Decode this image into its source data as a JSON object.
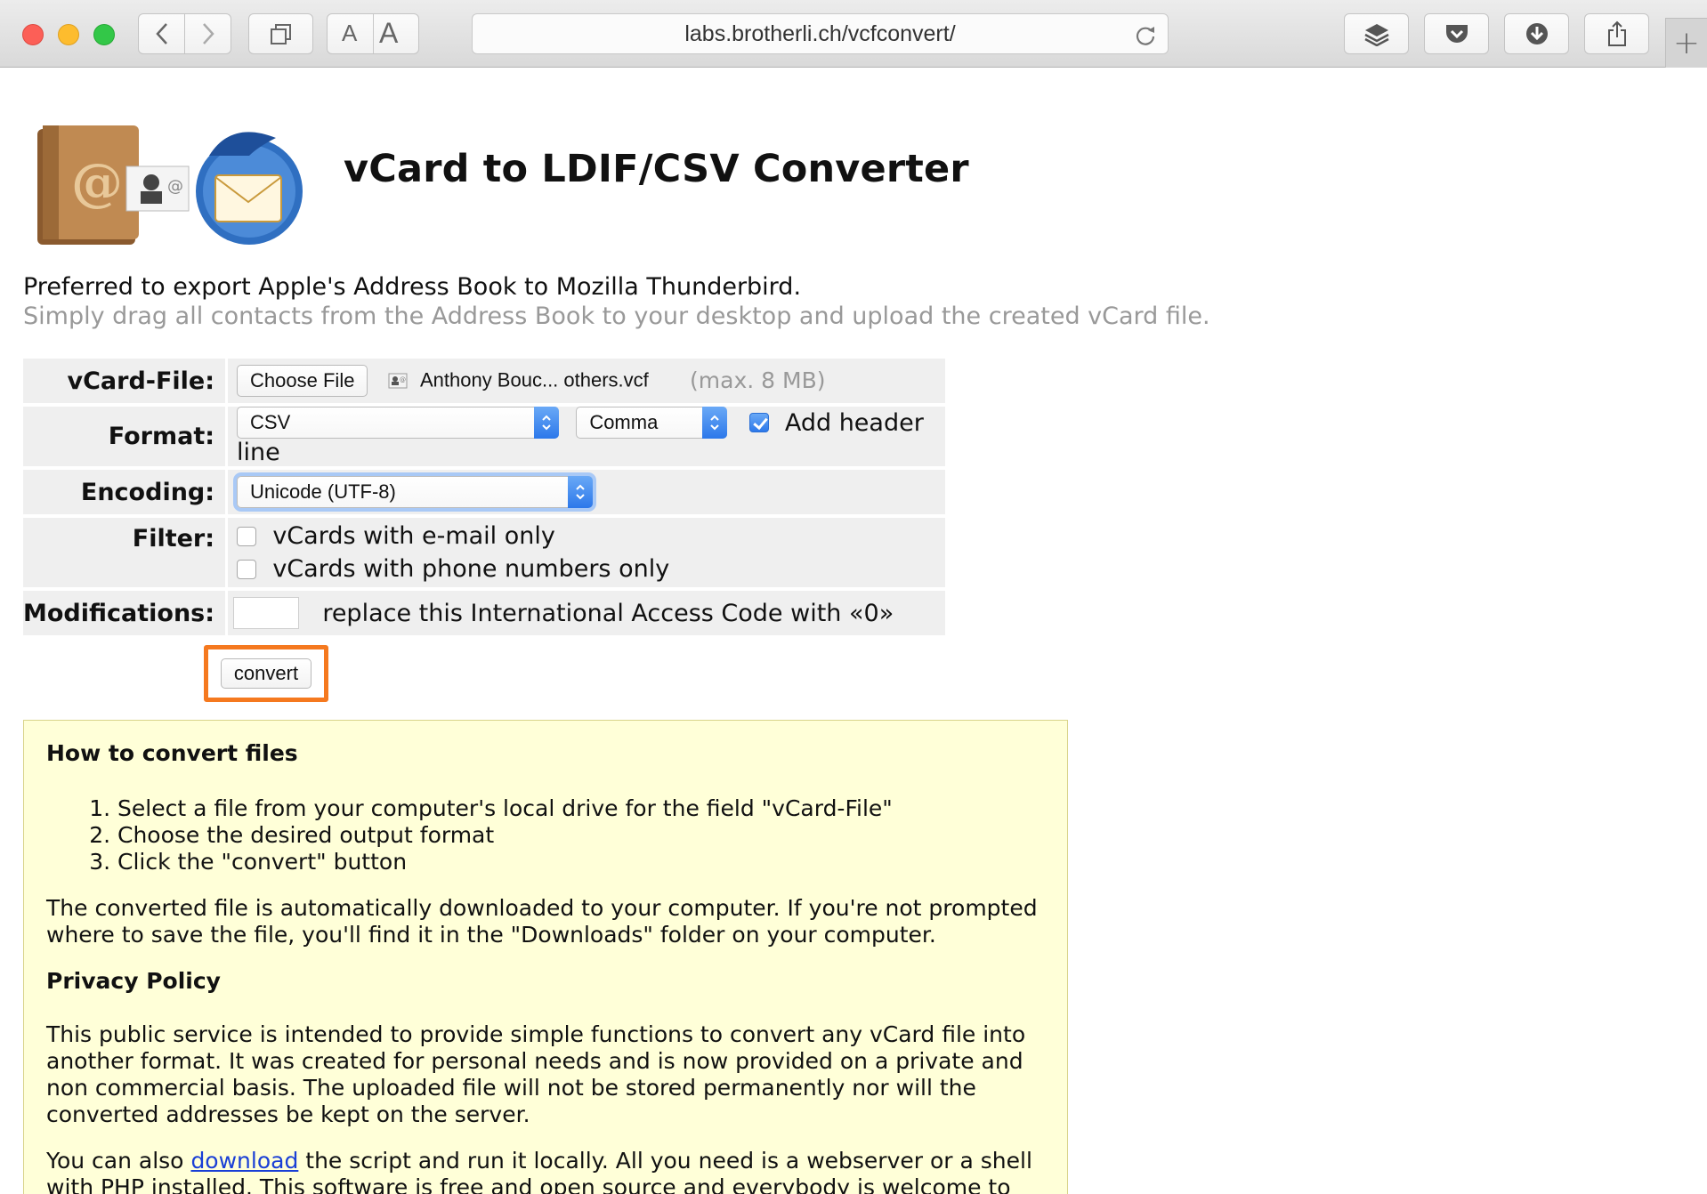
{
  "browser": {
    "url": "labs.brotherli.ch/vcfconvert/",
    "font_small_label": "A",
    "font_large_label": "A",
    "new_tab_label": "+"
  },
  "page": {
    "title": "vCard to LDIF/CSV Converter",
    "intro": "Preferred to export Apple's Address Book to Mozilla Thunderbird.",
    "intro_sub": "Simply drag all contacts from the Address Book to your desktop and upload the created vCard file."
  },
  "form": {
    "vcard_label": "vCard-File:",
    "choose_file_label": "Choose File",
    "file_name": "Anthony Bouc... others.vcf",
    "max_size": "(max. 8 MB)",
    "format_label": "Format:",
    "format_value": "CSV",
    "delimiter_value": "Comma",
    "header_line_label": "Add header line",
    "header_line_checked": true,
    "encoding_label": "Encoding:",
    "encoding_value": "Unicode (UTF-8)",
    "filter_label": "Filter:",
    "filter_email_label": "vCards with e-mail only",
    "filter_phone_label": "vCards with phone numbers only",
    "modifications_label": "Modifications:",
    "modifications_text": "replace this International Access Code with «0»",
    "modifications_value": "",
    "convert_label": "convert"
  },
  "info": {
    "howto_title": "How to convert files",
    "steps": [
      "Select a file from your computer's local drive for the field \"vCard-File\"",
      "Choose the desired output format",
      "Click the \"convert\" button"
    ],
    "download_note": "The converted file is automatically downloaded to your computer. If you're not prompted where to save the file, you'll find it in the \"Downloads\" folder on your computer.",
    "privacy_title": "Privacy Policy",
    "privacy_text": "This public service is intended to provide simple functions to convert any vCard file into another format. It was created for personal needs and is now provided on a private and non commercial basis. The uploaded file will not be stored permanently nor will the converted addresses be kept on the server.",
    "also_prefix": "You can also ",
    "also_link": "download",
    "also_suffix": " the script and run it locally. All you need is a webserver or a shell with PHP installed. This software is free and open source and everybody is welcome to help us"
  },
  "colors": {
    "highlight_border": "#f5791f",
    "info_background": "#ffffd8",
    "select_accent": "#2c78ea",
    "link": "#1a3fd6"
  },
  "icons": [
    "back-icon",
    "forward-icon",
    "tabs-icon",
    "reload-icon",
    "layers-icon",
    "pocket-icon",
    "download-icon",
    "share-icon",
    "vcard-file-icon",
    "address-book-logo"
  ]
}
